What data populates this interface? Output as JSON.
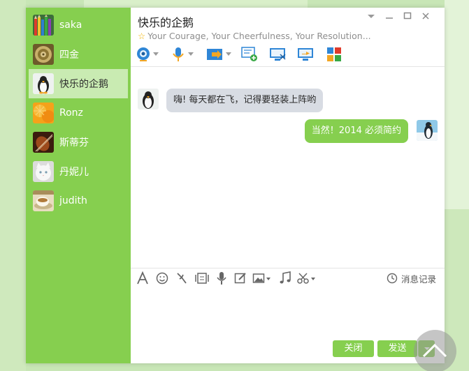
{
  "sidebar": {
    "contacts": [
      {
        "name": "saka"
      },
      {
        "name": "四金"
      },
      {
        "name": "快乐的企鹅",
        "active": true
      },
      {
        "name": "Ronz"
      },
      {
        "name": "斯蒂芬"
      },
      {
        "name": "丹妮儿"
      },
      {
        "name": "judith"
      }
    ]
  },
  "chat": {
    "title": "快乐的企鹅",
    "signature": "Your Courage, Your Cheerfulness, Your Resolution..."
  },
  "toolbar": {
    "icons": [
      "video-call-icon",
      "voice-call-icon",
      "file-transfer-icon",
      "create-discussion-icon",
      "remote-desktop-icon",
      "share-screen-icon",
      "apps-grid-icon"
    ]
  },
  "messages": [
    {
      "direction": "in",
      "text": "嗨! 每天都在飞，记得要轻装上阵哟"
    },
    {
      "direction": "out",
      "text": "当然！2014 必须简约"
    }
  ],
  "input_toolbar": {
    "icons": [
      "font-icon",
      "emoji-icon",
      "nudge-icon",
      "gif-icon",
      "voice-message-icon",
      "edit-icon",
      "image-icon",
      "music-icon",
      "screenshot-icon"
    ],
    "history_label": "消息记录"
  },
  "buttons": {
    "close_label": "关闭",
    "send_label": "发送"
  },
  "colors": {
    "accent_green": "#86cf4f",
    "active_contact_bg": "#c9ebb2",
    "incoming_bubble": "#d8dce3",
    "background": "#c8e6b6"
  }
}
